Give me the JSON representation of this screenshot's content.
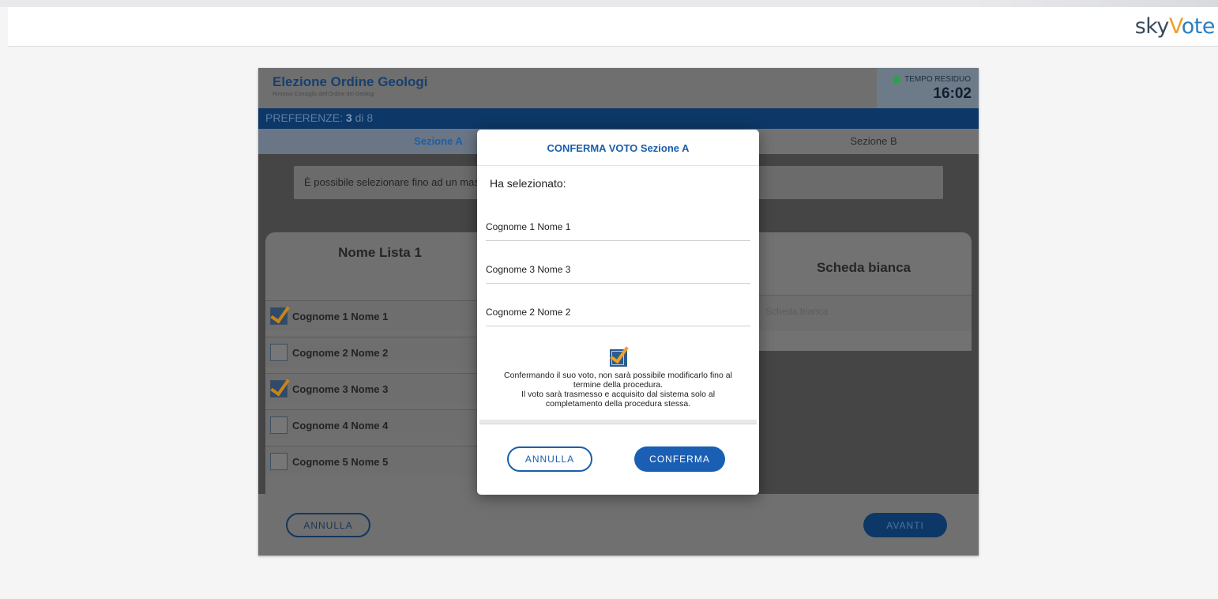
{
  "app": {
    "logo_sky": "sky",
    "logo_v": "V",
    "logo_ote": "ote"
  },
  "election": {
    "title": "Elezione Ordine Geologi",
    "subtitle": "Rinnovo Consiglio dell'Ordine dei Geologi",
    "timer_label": "TEMPO RESIDUO",
    "timer_value": "16:02",
    "preferences_label": "PREFERENZE:",
    "preferences_count": "3",
    "preferences_of": "di 8"
  },
  "tabs": {
    "a": "Sezione A",
    "b": "Sezione B"
  },
  "info": "È possibile selezionare fino ad un mass",
  "list": {
    "title": "Nome Lista 1",
    "candidates": [
      {
        "name": "Cognome 1 Nome 1",
        "checked": true
      },
      {
        "name": "Cognome 2 Nome 2",
        "checked": false
      },
      {
        "name": "Cognome 3 Nome 3",
        "checked": true
      },
      {
        "name": "Cognome 4 Nome 4",
        "checked": false
      },
      {
        "name": "Cognome 5 Nome 5",
        "checked": false
      }
    ]
  },
  "scheda": {
    "title": "Scheda bianca",
    "option": "Scheda bianca"
  },
  "footer": {
    "cancel": "ANNULLA",
    "next": "AVANTI"
  },
  "modal": {
    "title": "CONFERMA VOTO Sezione A",
    "intro": "Ha selezionato:",
    "selections": [
      "Cognome 1 Nome 1",
      "Cognome 3 Nome 3",
      "Cognome 2 Nome 2"
    ],
    "warning_line1": "Confermando il suo voto, non sarà possibile modificarlo fino al termine della procedura.",
    "warning_line2": "Il voto sarà trasmesso e acquisito dal sistema solo al completamento della procedura stessa.",
    "cancel": "ANNULLA",
    "confirm": "CONFERMA"
  },
  "colors": {
    "accent": "#1a5faa",
    "brand_orange": "#f0a024",
    "navy": "#0d3766"
  }
}
